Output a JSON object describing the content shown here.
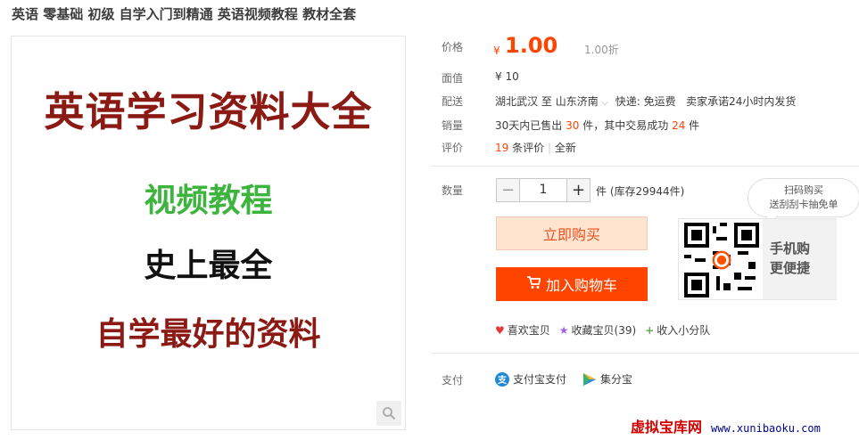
{
  "title": "英语 零基础 初级 自学入门到精通 英语视频教程 教材全套",
  "image": {
    "line1": "英语学习资料大全",
    "line2": "视频教程",
    "line3": "史上最全",
    "line4": "自学最好的资料",
    "zoom_icon": "magnifier-icon"
  },
  "labels": {
    "price": "价格",
    "face_value": "面值",
    "delivery": "配送",
    "sales": "销量",
    "reviews": "评价",
    "quantity": "数量",
    "payment": "支付"
  },
  "price": {
    "currency": "¥",
    "value": "1.00",
    "discount": "1.00折"
  },
  "face_value": "¥ 10",
  "delivery": {
    "from": "湖北武汉",
    "to_word": "至",
    "to": "山东济南",
    "shipping": "快递: 免运费",
    "promise": "卖家承诺24小时内发货"
  },
  "sales": {
    "prefix": "30天内已售出",
    "sold": "30",
    "mid": "件，其中交易成功",
    "success": "24",
    "suffix": "件"
  },
  "reviews": {
    "count": "19",
    "count_label": "条评价",
    "sep": "|",
    "new": "全新"
  },
  "quantity": {
    "minus": "−",
    "value": "1",
    "plus": "+",
    "stock": "件 (库存29944件)"
  },
  "buttons": {
    "buy_now": "立即购买",
    "add_cart": "加入购物车"
  },
  "actions": {
    "like": "喜欢宝贝",
    "fav": "收藏宝贝(39)",
    "team": "收入小分队"
  },
  "payment": {
    "alipay": "支付宝支付",
    "jifenbao": "集分宝"
  },
  "qr": {
    "line1": "手机购",
    "line2": "更便捷",
    "bubble1": "扫码购买",
    "bubble2": "送刮刮卡抽免单"
  },
  "watermark": {
    "cn": "虚拟宝库网",
    "url": "www.xunibaoku.com"
  },
  "colors": {
    "accent": "#ff4400",
    "buy_bg": "#ffe4d0"
  }
}
